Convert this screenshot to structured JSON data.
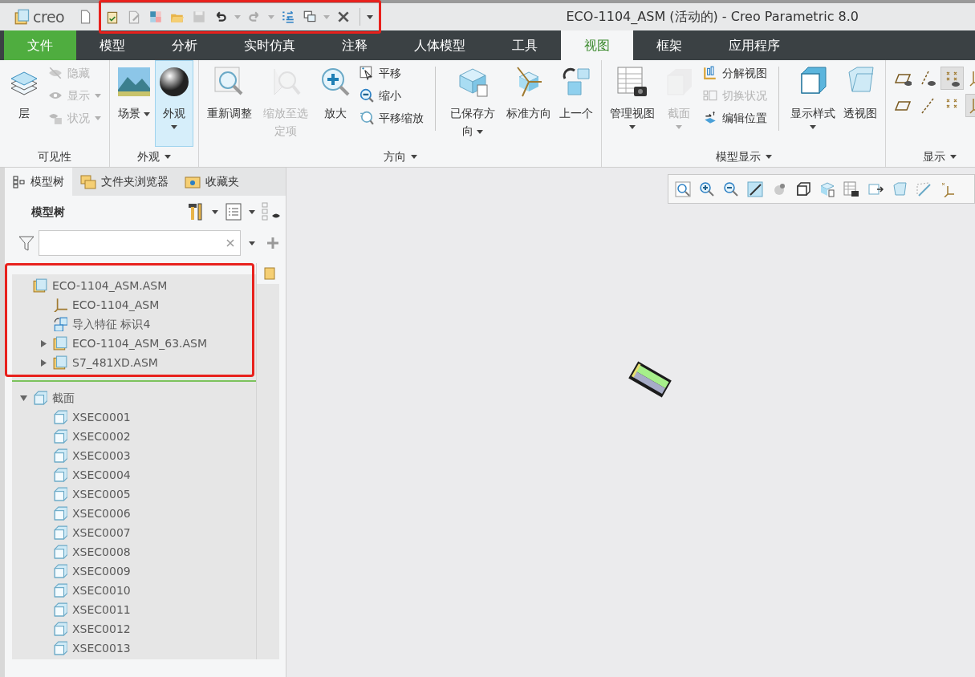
{
  "title_bar": {
    "logo": "creo",
    "title": "ECO-1104_ASM (活动的) - Creo Parametric 8.0"
  },
  "quick_access_toolbar": {
    "highlighted": true
  },
  "ribbon_tabs": [
    {
      "label": "文件",
      "kind": "file",
      "selected": false
    },
    {
      "label": "模型",
      "kind": "normal",
      "selected": false
    },
    {
      "label": "分析",
      "kind": "normal",
      "selected": false
    },
    {
      "label": "实时仿真",
      "kind": "normal",
      "selected": false
    },
    {
      "label": "注释",
      "kind": "normal",
      "selected": false
    },
    {
      "label": "人体模型",
      "kind": "normal",
      "selected": false
    },
    {
      "label": "工具",
      "kind": "normal",
      "selected": false
    },
    {
      "label": "视图",
      "kind": "normal",
      "selected": true
    },
    {
      "label": "框架",
      "kind": "normal",
      "selected": false
    },
    {
      "label": "应用程序",
      "kind": "normal",
      "selected": false
    }
  ],
  "ribbon_groups": [
    {
      "label": "可见性",
      "dropdown": false,
      "items": [
        {
          "kind": "large",
          "label": "层",
          "dropdown": false,
          "disabled": false
        },
        {
          "kind": "small",
          "label": "隐藏",
          "dropdown": false,
          "disabled": true
        },
        {
          "kind": "small",
          "label": "显示",
          "dropdown": true,
          "disabled": true
        },
        {
          "kind": "small",
          "label": "状况",
          "dropdown": true,
          "disabled": true
        }
      ]
    },
    {
      "label": "外观",
      "dropdown": true,
      "items": [
        {
          "kind": "large",
          "label": "场景",
          "dropdown": true,
          "disabled": false
        },
        {
          "kind": "split",
          "label": "外观",
          "dropdown": true,
          "disabled": false,
          "selected": true
        }
      ]
    },
    {
      "label": "方向",
      "dropdown": true,
      "items": [
        {
          "kind": "large",
          "label": "重新调整",
          "dropdown": false,
          "disabled": false
        },
        {
          "kind": "large",
          "label": "缩放至选定项",
          "dropdown": false,
          "disabled": true
        },
        {
          "kind": "large",
          "label": "放大",
          "dropdown": false,
          "disabled": false
        },
        {
          "kind": "small",
          "label": "平移",
          "dropdown": false,
          "disabled": false
        },
        {
          "kind": "small",
          "label": "缩小",
          "dropdown": false,
          "disabled": false
        },
        {
          "kind": "small",
          "label": "平移缩放",
          "dropdown": false,
          "disabled": false
        },
        {
          "kind": "separator"
        },
        {
          "kind": "large",
          "label": "已保存方向",
          "dropdown": true,
          "disabled": false
        },
        {
          "kind": "large",
          "label": "标准方向",
          "dropdown": false,
          "disabled": false
        },
        {
          "kind": "large",
          "label": "上一个",
          "dropdown": false,
          "disabled": false
        }
      ]
    },
    {
      "label": "模型显示",
      "dropdown": true,
      "items": [
        {
          "kind": "split",
          "label": "管理视图",
          "dropdown": true,
          "disabled": false
        },
        {
          "kind": "split",
          "label": "截面",
          "dropdown": true,
          "disabled": true
        },
        {
          "kind": "small",
          "label": "分解视图",
          "dropdown": false,
          "disabled": false
        },
        {
          "kind": "small",
          "label": "切换状况",
          "dropdown": false,
          "disabled": true
        },
        {
          "kind": "small",
          "label": "编辑位置",
          "dropdown": false,
          "disabled": false
        },
        {
          "kind": "separator"
        },
        {
          "kind": "split",
          "label": "显示样式",
          "dropdown": true,
          "disabled": false
        },
        {
          "kind": "large",
          "label": "透视图",
          "dropdown": false,
          "disabled": false
        }
      ]
    },
    {
      "label": "显示",
      "dropdown": true,
      "items": [
        {
          "kind": "toggle",
          "selected": false
        },
        {
          "kind": "toggle",
          "selected": false
        },
        {
          "kind": "toggle",
          "selected": true
        },
        {
          "kind": "toggle",
          "selected": false
        },
        {
          "kind": "toggle",
          "selected": false
        },
        {
          "kind": "toggle",
          "selected": false
        },
        {
          "kind": "toggle",
          "selected": false
        },
        {
          "kind": "toggle",
          "selected": true
        }
      ]
    }
  ],
  "panel_tabs": [
    {
      "label": "模型树",
      "selected": true
    },
    {
      "label": "文件夹浏览器",
      "selected": false
    },
    {
      "label": "收藏夹",
      "selected": false
    }
  ],
  "model_tree": {
    "heading": "模型树",
    "sections": [
      {
        "highlighted": true,
        "items": [
          {
            "kind": "assembly",
            "label": "ECO-1104_ASM.ASM",
            "children": [
              {
                "kind": "csys",
                "label": "ECO-1104_ASM"
              },
              {
                "kind": "import",
                "label": "导入特征 标识4"
              },
              {
                "kind": "assembly",
                "label": "ECO-1104_ASM_63.ASM",
                "expanded": false
              },
              {
                "kind": "assembly",
                "label": "S7_481XD.ASM",
                "expanded": false
              }
            ]
          }
        ]
      },
      {
        "highlighted": false,
        "items": [
          {
            "kind": "folder",
            "label": "截面",
            "expanded": true,
            "children": [
              {
                "kind": "section",
                "label": "XSEC0001"
              },
              {
                "kind": "section",
                "label": "XSEC0002"
              },
              {
                "kind": "section",
                "label": "XSEC0003"
              },
              {
                "kind": "section",
                "label": "XSEC0004"
              },
              {
                "kind": "section",
                "label": "XSEC0005"
              },
              {
                "kind": "section",
                "label": "XSEC0006"
              },
              {
                "kind": "section",
                "label": "XSEC0007"
              },
              {
                "kind": "section",
                "label": "XSEC0008"
              },
              {
                "kind": "section",
                "label": "XSEC0009"
              },
              {
                "kind": "section",
                "label": "XSEC0010"
              },
              {
                "kind": "section",
                "label": "XSEC0011"
              },
              {
                "kind": "section",
                "label": "XSEC0012"
              },
              {
                "kind": "section",
                "label": "XSEC0013"
              }
            ]
          }
        ]
      }
    ]
  }
}
